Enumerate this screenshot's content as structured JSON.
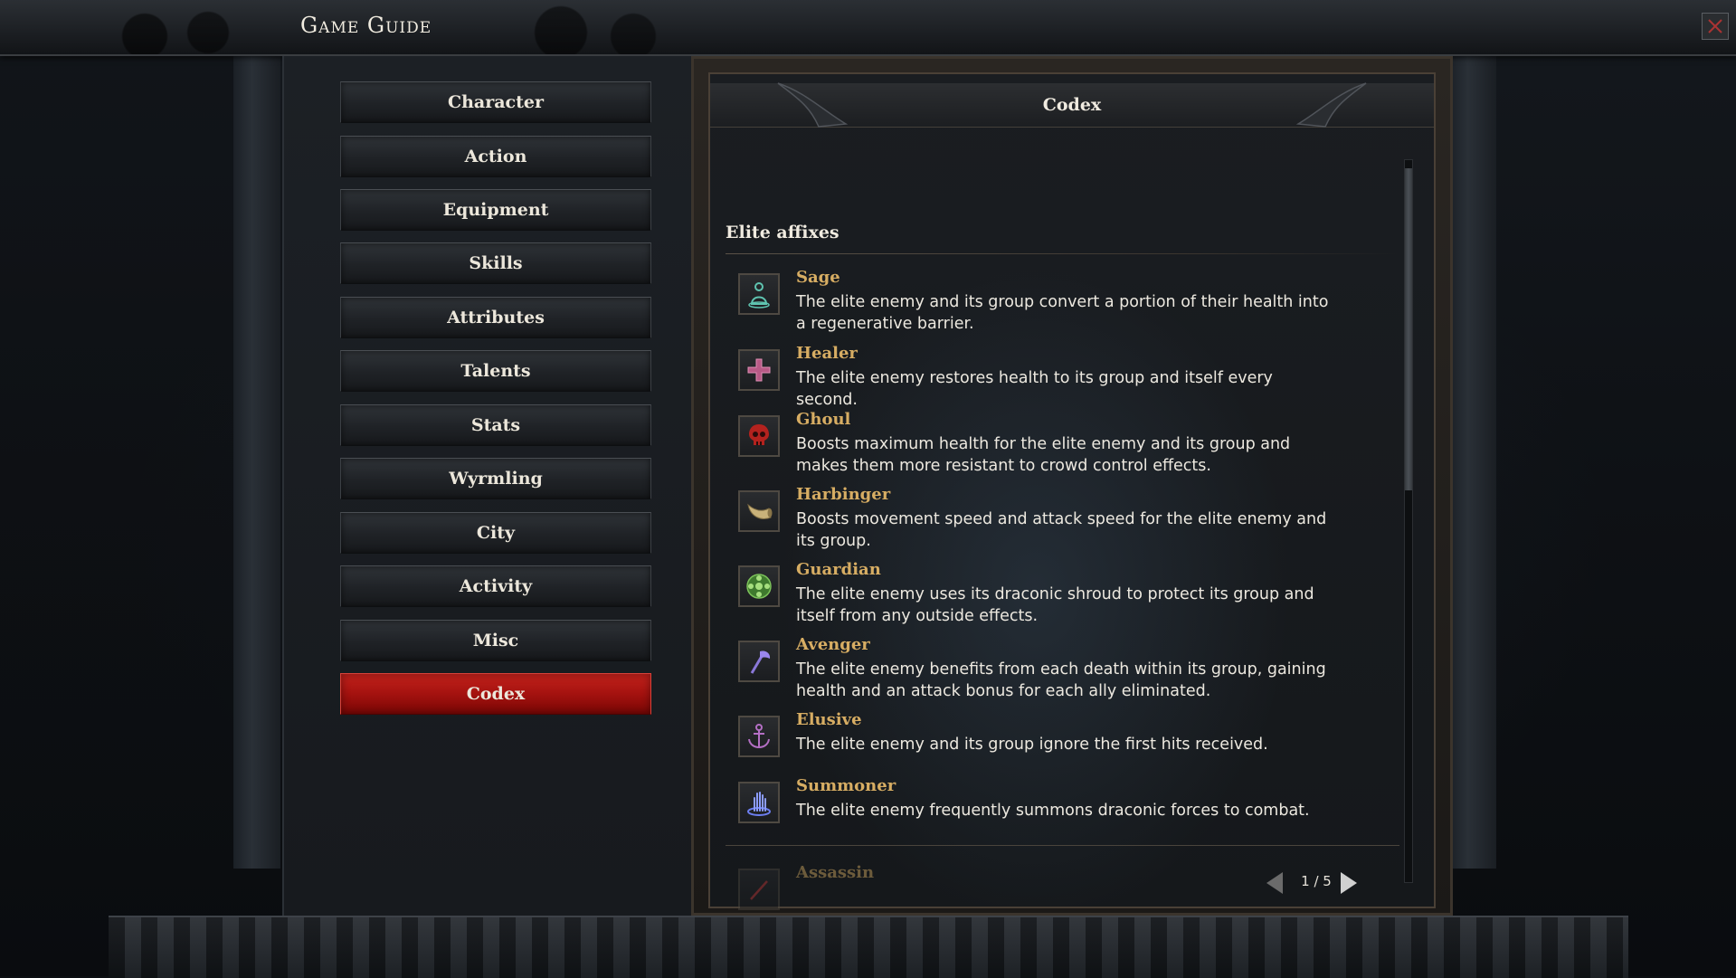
{
  "window": {
    "title": "Game Guide"
  },
  "nav": {
    "items": [
      {
        "label": "Character"
      },
      {
        "label": "Action"
      },
      {
        "label": "Equipment"
      },
      {
        "label": "Skills"
      },
      {
        "label": "Attributes"
      },
      {
        "label": "Talents"
      },
      {
        "label": "Stats"
      },
      {
        "label": "Wyrmling"
      },
      {
        "label": "City"
      },
      {
        "label": "Activity"
      },
      {
        "label": "Misc"
      },
      {
        "label": "Codex"
      }
    ],
    "active": "Codex"
  },
  "codex": {
    "header": "Codex",
    "section_title": "Elite affixes",
    "affixes": [
      {
        "name": "Sage",
        "icon": "meditating-figure-icon",
        "description": "The elite enemy and its group convert a portion of their health into a regenerative barrier."
      },
      {
        "name": "Healer",
        "icon": "cross-icon",
        "description": "The elite enemy restores health to its group and itself every second."
      },
      {
        "name": "Ghoul",
        "icon": "red-skull-icon",
        "description": "Boosts maximum health for the elite enemy and its group and makes them more resistant to crowd control effects."
      },
      {
        "name": "Harbinger",
        "icon": "horn-icon",
        "description": "Boosts movement speed and attack speed for the elite enemy and its group."
      },
      {
        "name": "Guardian",
        "icon": "green-shield-emblem-icon",
        "description": "The elite enemy uses its draconic shroud to protect its group and itself from any outside effects."
      },
      {
        "name": "Avenger",
        "icon": "purple-axe-icon",
        "description": "The elite enemy benefits from each death within its group, gaining health and an attack bonus for each ally eliminated."
      },
      {
        "name": "Elusive",
        "icon": "anchor-icon",
        "description": "The elite enemy and its group ignore the first hits received."
      },
      {
        "name": "Summoner",
        "icon": "summoning-hand-icon",
        "description": "The elite enemy frequently summons draconic forces to combat."
      },
      {
        "name": "Assassin",
        "icon": "dagger-icon",
        "description": ""
      }
    ],
    "pagination": {
      "text": "1 / 5",
      "current": 1,
      "total": 5
    }
  },
  "colors": {
    "accent_active": "#b5170f",
    "affix_name": "#d7ad63",
    "text": "#ece8df"
  }
}
